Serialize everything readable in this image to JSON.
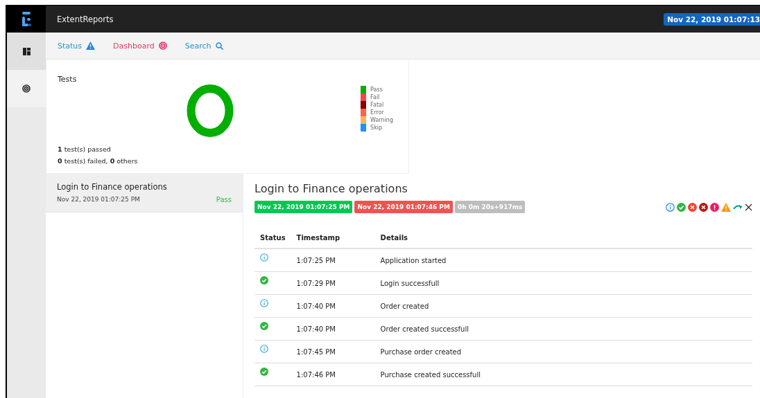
{
  "header": {
    "title": "ExtentReports",
    "date_badge": "Nov 22, 2019 01:07:13"
  },
  "sidebar": {
    "items": [
      {
        "kind": "dashboard",
        "selected": true
      },
      {
        "kind": "target",
        "selected": false
      }
    ]
  },
  "nav": [
    {
      "label": "Status",
      "kind": "status"
    },
    {
      "label": "Dashboard",
      "kind": "dashboard"
    },
    {
      "label": "Search",
      "kind": "search"
    }
  ],
  "tests_card": {
    "title": "Tests",
    "legend": [
      {
        "label": "Pass",
        "color": "#00af00"
      },
      {
        "label": "Fail",
        "color": "#f7464a"
      },
      {
        "label": "Fatal",
        "color": "#8b0000"
      },
      {
        "label": "Error",
        "color": "#ff6347"
      },
      {
        "label": "Warning",
        "color": "#fdb45c"
      },
      {
        "label": "Skip",
        "color": "#1e90ff"
      }
    ],
    "summary": [
      "**1** test(s) passed",
      "**0** test(s) failed, **0** others"
    ]
  },
  "test_list": [
    {
      "name": "Login to Finance operations",
      "time": "Nov 22, 2019 01:07:25 PM",
      "status": "Pass",
      "selected": true
    }
  ],
  "detail": {
    "title": "Login to Finance operations",
    "badges": [
      {
        "text": "Nov 22, 2019 01:07:25 PM",
        "kind": "start"
      },
      {
        "text": "Nov 22, 2019 01:07:46 PM",
        "kind": "end"
      },
      {
        "text": "0h 0m 20s+917ms",
        "kind": "duration"
      }
    ],
    "filters": [
      {
        "kind": "info"
      },
      {
        "kind": "pass"
      },
      {
        "kind": "fail"
      },
      {
        "kind": "fatal"
      },
      {
        "kind": "error"
      },
      {
        "kind": "warning"
      },
      {
        "kind": "skip"
      },
      {
        "kind": "clear"
      }
    ],
    "columns": [
      "Status",
      "Timestamp",
      "Details"
    ],
    "rows": [
      {
        "kind": "info",
        "time": "1:07:25 PM",
        "details": "Application started"
      },
      {
        "kind": "pass",
        "time": "1:07:29 PM",
        "details": "Login successfull"
      },
      {
        "kind": "info",
        "time": "1:07:40 PM",
        "details": "Order created"
      },
      {
        "kind": "pass",
        "time": "1:07:40 PM",
        "details": "Order created successfull"
      },
      {
        "kind": "info",
        "time": "1:07:45 PM",
        "details": "Purchase order created"
      },
      {
        "kind": "pass",
        "time": "1:07:46 PM",
        "details": "Purchase created successfull"
      }
    ]
  }
}
